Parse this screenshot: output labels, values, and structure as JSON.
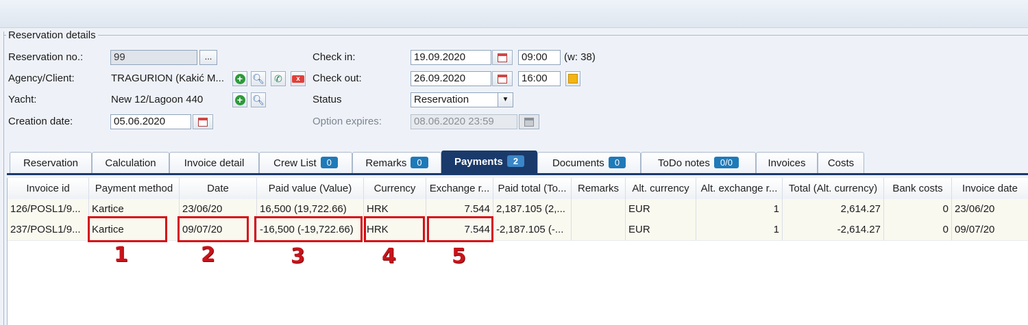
{
  "section_title": "Reservation details",
  "form": {
    "reservation_no_label": "Reservation no.:",
    "reservation_no_value": "99",
    "browse_label": "...",
    "agency_label": "Agency/Client:",
    "agency_value": "TRAGURION (Kakić M...",
    "yacht_label": "Yacht:",
    "yacht_value": "New 12/Lagoon 440",
    "creation_date_label": "Creation date:",
    "creation_date_value": "05.06.2020",
    "check_in_label": "Check in:",
    "check_in_date": "19.09.2020",
    "check_in_time": "09:00",
    "week_text": "(w: 38)",
    "check_out_label": "Check out:",
    "check_out_date": "26.09.2020",
    "check_out_time": "16:00",
    "status_label": "Status",
    "status_value": "Reservation",
    "option_expires_label": "Option expires:",
    "option_expires_value": "08.06.2020 23:59"
  },
  "tabs": [
    {
      "label": "Reservation",
      "badge": ""
    },
    {
      "label": "Calculation",
      "badge": ""
    },
    {
      "label": "Invoice detail",
      "badge": ""
    },
    {
      "label": "Crew List",
      "badge": "0"
    },
    {
      "label": "Remarks",
      "badge": "0"
    },
    {
      "label": "Payments",
      "badge": "2"
    },
    {
      "label": "Documents",
      "badge": "0"
    },
    {
      "label": "ToDo notes",
      "badge": "0/0"
    },
    {
      "label": "Invoices",
      "badge": ""
    },
    {
      "label": "Costs",
      "badge": ""
    }
  ],
  "active_tab": "Payments",
  "table": {
    "columns": [
      "Invoice id",
      "Payment method",
      "Date",
      "Paid value (Value)",
      "Currency",
      "Exchange r...",
      "Paid total (To...",
      "Remarks",
      "Alt. currency",
      "Alt. exchange r...",
      "Total (Alt. currency)",
      "Bank costs",
      "Invoice date"
    ],
    "rows": [
      [
        "126/POSL1/9...",
        "Kartice",
        "23/06/20",
        "16,500 (19,722.66)",
        "HRK",
        "7.544",
        "2,187.105 (2,...",
        "",
        "EUR",
        "1",
        "2,614.27",
        "0",
        "23/06/20"
      ],
      [
        "237/POSL1/9...",
        "Kartice",
        "09/07/20",
        "-16,500 (-19,722.66)",
        "HRK",
        "7.544",
        "-2,187.105 (-...",
        "",
        "EUR",
        "1",
        "-2,614.27",
        "0",
        "09/07/20"
      ]
    ]
  },
  "annotations": [
    "1",
    "2",
    "3",
    "4",
    "5"
  ],
  "colors": {
    "annotation": "#d60d14",
    "active_tab": "#1a3a6b",
    "badge": "#1f7ab8"
  }
}
